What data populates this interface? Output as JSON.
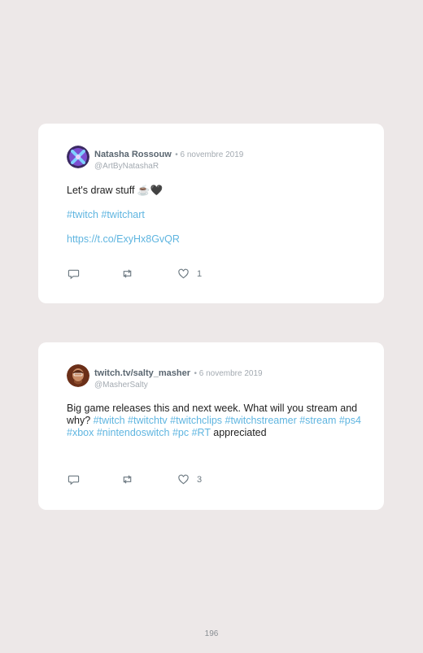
{
  "tweets": [
    {
      "name": "Natasha Rossouw",
      "date": "• 6 novembre 2019",
      "handle": "@ArtByNatashaR",
      "text": "Let's draw stuff ☕🖤",
      "hashtags": "#twitch #twitchart",
      "link": "https://t.co/ExyHx8GvQR",
      "like_count": "1",
      "avatar_colors": [
        "#8a4fd6",
        "#3aa4e6"
      ]
    },
    {
      "name": "twitch.tv/salty_masher",
      "date": "• 6 novembre 2019",
      "handle": "@MasherSalty",
      "text_start": "Big game releases this and next week. What will you stream and why?",
      "hashtags_inline": "#twitch #twitchtv #twitchclips #twitchstreamer #stream #ps4 #xbox #nintendoswitch #pc",
      "rt_tag": "#RT",
      "text_end": "appreciated",
      "like_count": "3",
      "avatar_colors": [
        "#7a3a20",
        "#c68a64"
      ]
    }
  ],
  "page_number": "196",
  "colors": {
    "background": "#ede8e8",
    "card": "#ffffff",
    "hashtag": "#5fb5e0"
  },
  "icons": [
    "reply-icon",
    "retweet-icon",
    "like-icon"
  ]
}
